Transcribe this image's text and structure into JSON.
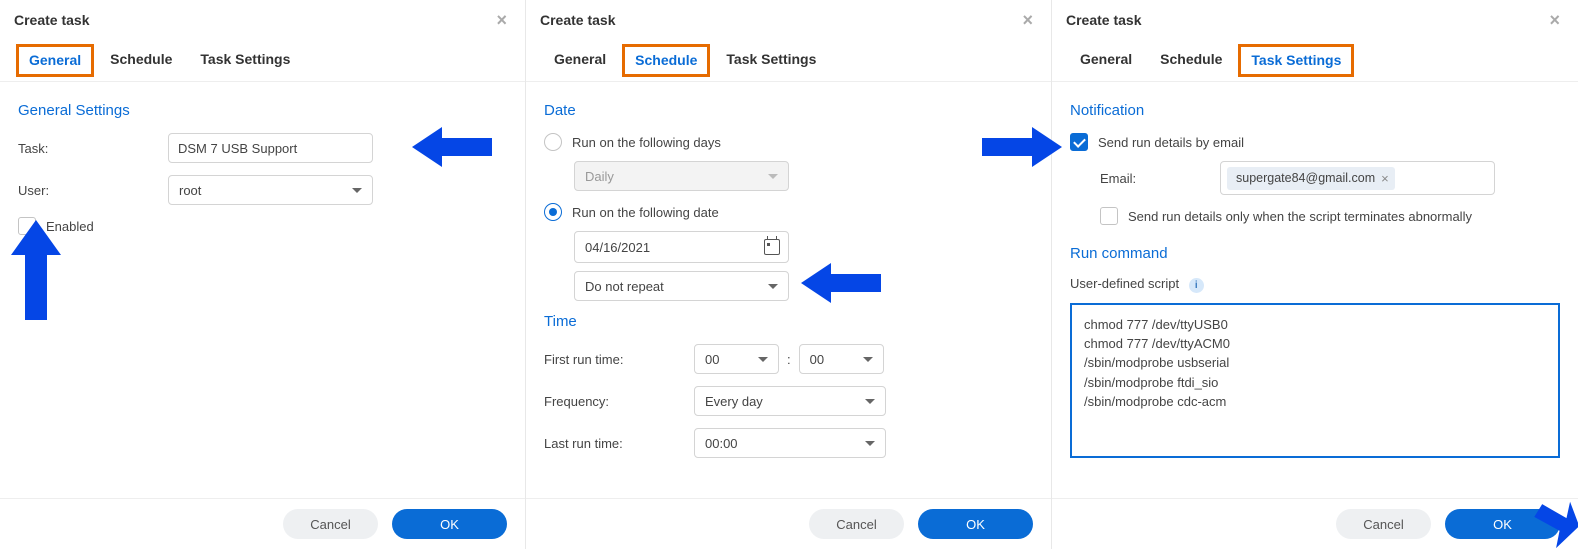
{
  "dialog_title": "Create task",
  "tabs": {
    "general": "General",
    "schedule": "Schedule",
    "task_settings": "Task Settings"
  },
  "buttons": {
    "cancel": "Cancel",
    "ok": "OK"
  },
  "general": {
    "section": "General Settings",
    "task_label": "Task:",
    "task_value": "DSM 7 USB Support",
    "user_label": "User:",
    "user_value": "root",
    "enabled_label": "Enabled",
    "enabled_checked": false
  },
  "schedule": {
    "date_section": "Date",
    "run_days_label": "Run on the following days",
    "days_value": "Daily",
    "run_date_label": "Run on the following date",
    "date_value": "04/16/2021",
    "repeat_value": "Do not repeat",
    "time_section": "Time",
    "first_run_label": "First run time:",
    "hour_value": "00",
    "minute_value": "00",
    "frequency_label": "Frequency:",
    "frequency_value": "Every day",
    "last_run_label": "Last run time:",
    "last_run_value": "00:00"
  },
  "task_settings": {
    "notification_section": "Notification",
    "send_email_label": "Send run details by email",
    "send_email_checked": true,
    "email_label": "Email:",
    "email_chip": "supergate84@gmail.com",
    "abnormal_label": "Send run details only when the script terminates abnormally",
    "abnormal_checked": false,
    "run_command_section": "Run command",
    "script_label": "User-defined script",
    "script_value": "chmod 777 /dev/ttyUSB0\nchmod 777 /dev/ttyACM0\n/sbin/modprobe usbserial\n/sbin/modprobe ftdi_sio\n/sbin/modprobe cdc-acm"
  },
  "colors": {
    "accent": "#0a6cd6",
    "highlight": "#e66b00",
    "arrow": "#0546e6"
  }
}
